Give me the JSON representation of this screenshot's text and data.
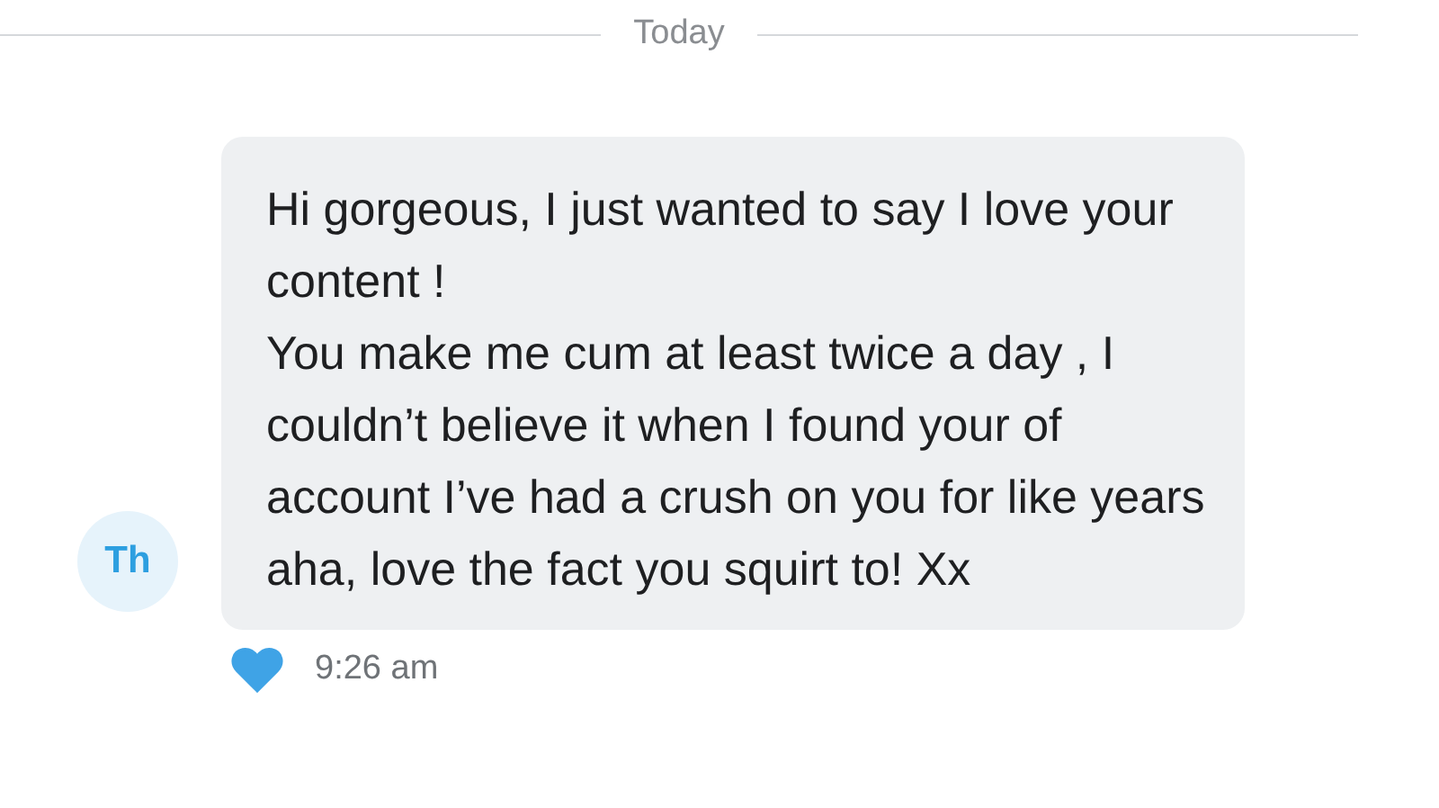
{
  "date_divider": "Today",
  "message": {
    "avatar": "Th",
    "text": "Hi gorgeous, I just wanted to say I love your content !\nYou make me cum at least twice a day , I couldn’t believe it when I found your of account I’ve had a crush on you for like years aha, love the fact you squirt to! Xx",
    "time": "9:26 am",
    "liked": true
  }
}
